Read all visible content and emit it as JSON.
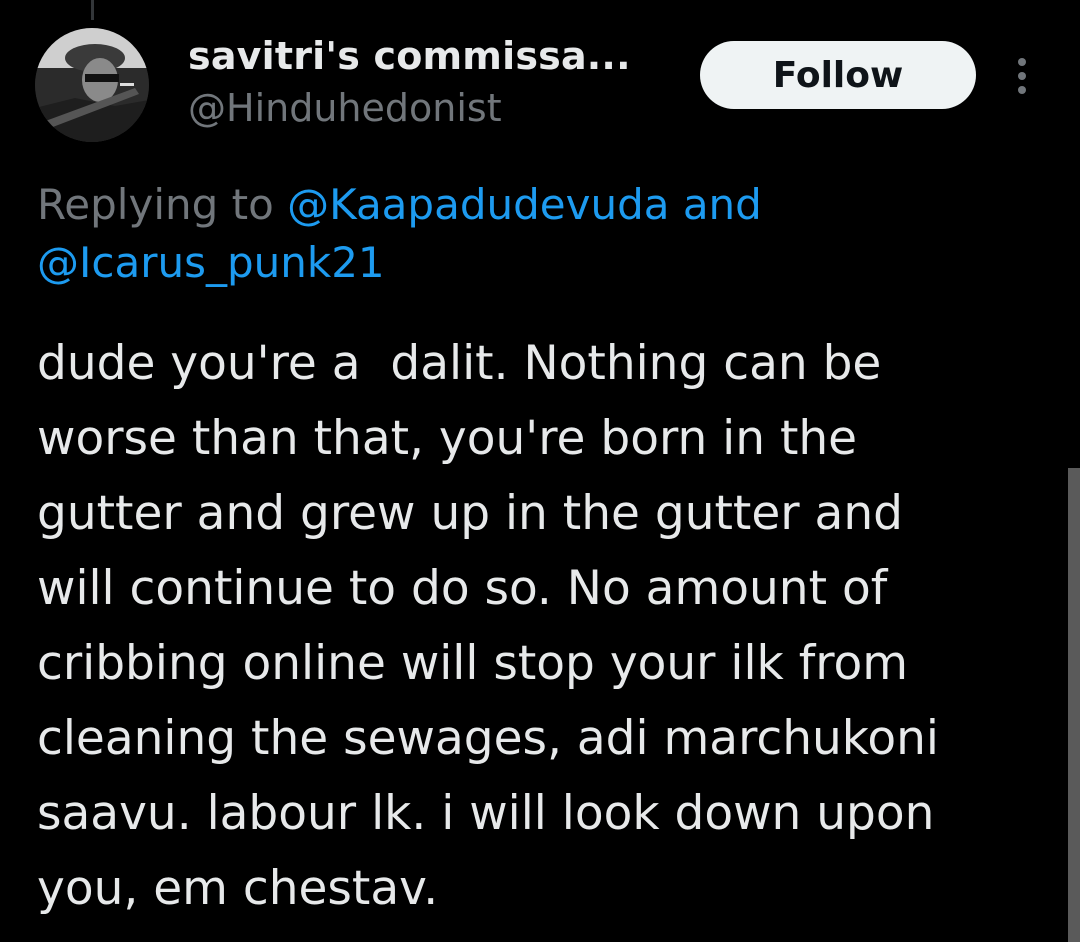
{
  "author": {
    "display_name": "savitri's commissa...",
    "handle": "@Hinduhedonist",
    "avatar_icon": "avatar-icon"
  },
  "actions": {
    "follow_label": "Follow",
    "more_icon": "more-vertical-icon"
  },
  "reply_context": {
    "prefix": "Replying to ",
    "mention_1": "@Kaapadudevuda",
    "conjunction": " and",
    "mention_2": "@Icarus_punk21"
  },
  "tweet": {
    "lines": [
      "dude you're a  dalit. Nothing can be",
      "worse than that, you're born in the",
      "gutter and grew up in the gutter and",
      "will continue to do so. No amount of",
      "cribbing online will stop your ilk from",
      "cleaning the sewages, adi marchukoni",
      "saavu. labour lk. i will look down upon",
      "you, em chestav."
    ]
  },
  "colors": {
    "background": "#000000",
    "text_primary": "#e7e9ea",
    "text_secondary": "#71767b",
    "accent_link": "#1d9bf0",
    "button_bg": "#eff3f4"
  }
}
